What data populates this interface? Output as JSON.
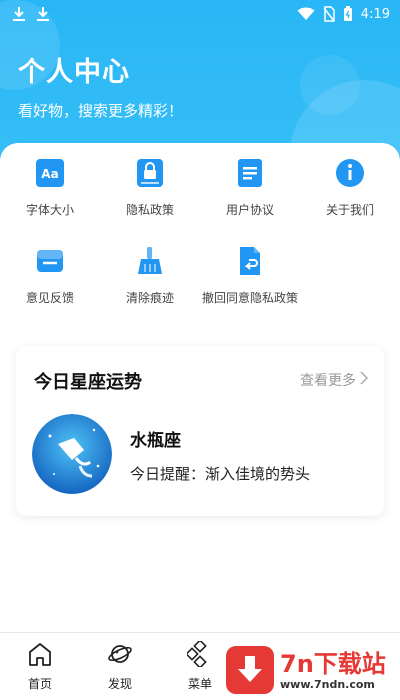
{
  "status_bar": {
    "time": "4:19"
  },
  "header": {
    "title": "个人中心",
    "subtitle": "看好物，搜索更多精彩！"
  },
  "menu": {
    "items": [
      {
        "label": "字体大小",
        "icon": "font-size-icon"
      },
      {
        "label": "隐私政策",
        "icon": "privacy-lock-icon"
      },
      {
        "label": "用户协议",
        "icon": "document-icon"
      },
      {
        "label": "关于我们",
        "icon": "info-icon"
      },
      {
        "label": "意见反馈",
        "icon": "feedback-inbox-icon"
      },
      {
        "label": "清除痕迹",
        "icon": "broom-icon"
      },
      {
        "label": "撤回同意隐私政策",
        "icon": "revoke-document-icon"
      }
    ]
  },
  "horoscope": {
    "section_title": "今日星座运势",
    "more_label": "查看更多",
    "sign_name": "水瓶座",
    "tip": "今日提醒：渐入佳境的势头"
  },
  "bottom_nav": {
    "items": [
      {
        "label": "首页",
        "icon": "home-icon"
      },
      {
        "label": "发现",
        "icon": "planet-icon"
      },
      {
        "label": "菜单",
        "icon": "menu-grid-icon"
      }
    ]
  },
  "watermark": {
    "main": "7n下载站",
    "url": "www.7ndn.com"
  },
  "colors": {
    "primary": "#29b6f6",
    "icon_blue": "#2196f3",
    "brand_red": "#e53935"
  }
}
